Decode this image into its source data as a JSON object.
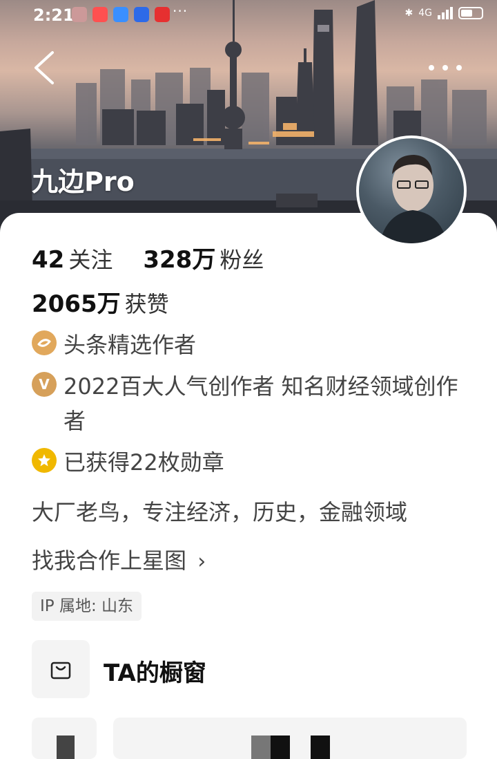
{
  "status_bar": {
    "time": "2:21",
    "network": "4G"
  },
  "profile": {
    "name": "九边Pro"
  },
  "stats": {
    "following_count": "42",
    "following_label": "关注",
    "followers_count": "328万",
    "followers_label": "粉丝",
    "likes_count": "2065万",
    "likes_label": "获赞"
  },
  "badges": [
    {
      "icon": "toutiao-select-icon",
      "text": "头条精选作者",
      "color": "#e1a85c"
    },
    {
      "icon": "v-verified-icon",
      "text": "2022百大人气创作者 知名财经领域创作者",
      "color": "#d6a05a"
    },
    {
      "icon": "medal-icon",
      "text": "已获得22枚勋章",
      "color": "#f0b800"
    }
  ],
  "bio": "大厂老鸟，专注经济，历史，金融领域",
  "collab_link": "找我合作上星图",
  "ip_location": "IP 属地: 山东",
  "shop": {
    "icon": "shopping-bag-icon",
    "label": "TA的橱窗"
  }
}
